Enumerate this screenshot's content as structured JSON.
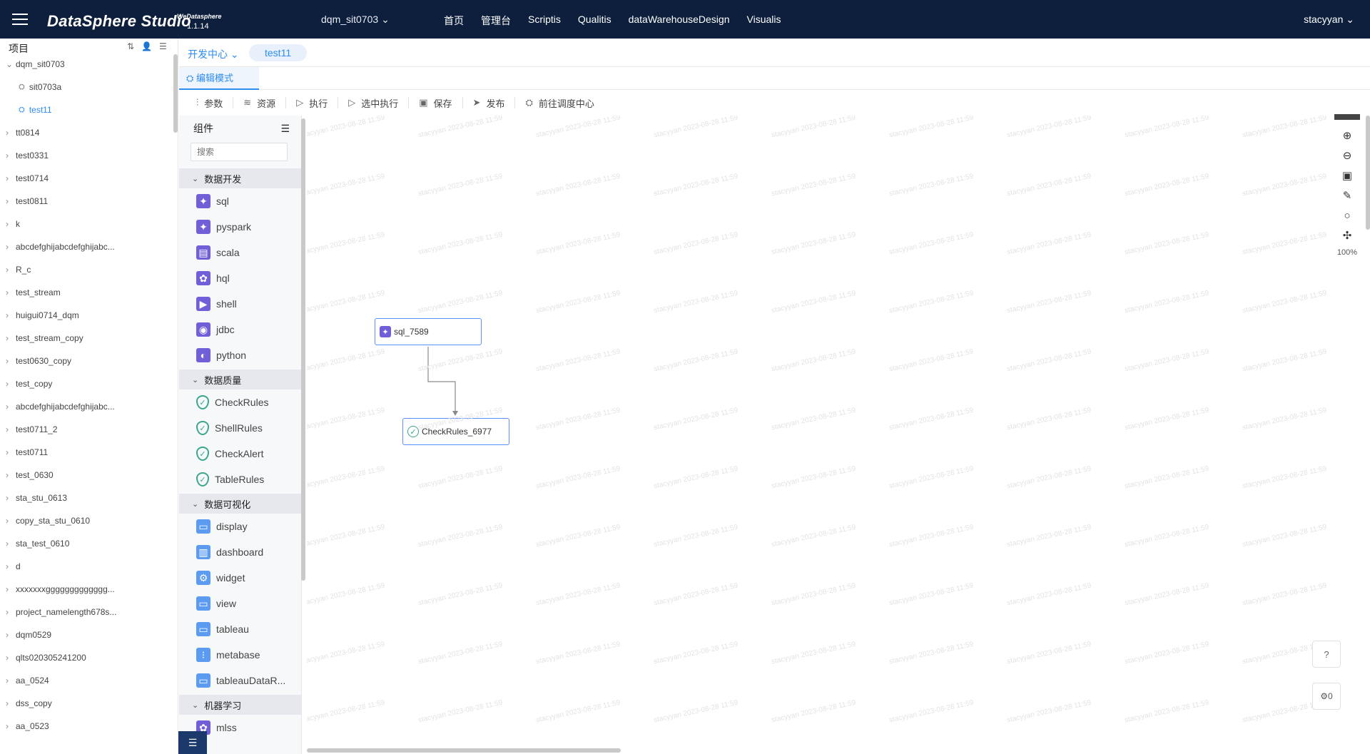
{
  "header": {
    "brand": "DataSphere Studio",
    "brand_sup": "WeDatasphere",
    "version": "1.1.14",
    "workspace": "dqm_sit0703",
    "nav": [
      "首页",
      "管理台",
      "Scriptis",
      "Qualitis",
      "dataWarehouseDesign",
      "Visualis"
    ],
    "user": "stacyyan"
  },
  "left_panel": {
    "title": "项目",
    "tree": [
      {
        "label": "dqm_sit0703",
        "expanded": true,
        "children": [
          {
            "label": "sit0703a",
            "active": false
          },
          {
            "label": "test11",
            "active": true
          }
        ]
      },
      {
        "label": "tt0814"
      },
      {
        "label": "test0331"
      },
      {
        "label": "test0714"
      },
      {
        "label": "test0811"
      },
      {
        "label": "k"
      },
      {
        "label": "abcdefghijabcdefghijabc..."
      },
      {
        "label": "R_c"
      },
      {
        "label": "test_stream"
      },
      {
        "label": "huigui0714_dqm"
      },
      {
        "label": "test_stream_copy"
      },
      {
        "label": "test0630_copy"
      },
      {
        "label": "test_copy"
      },
      {
        "label": "abcdefghijabcdefghijabc..."
      },
      {
        "label": "test0711_2"
      },
      {
        "label": "test0711"
      },
      {
        "label": "test_0630"
      },
      {
        "label": "sta_stu_0613"
      },
      {
        "label": "copy_sta_stu_0610"
      },
      {
        "label": "sta_test_0610"
      },
      {
        "label": "d"
      },
      {
        "label": "xxxxxxxggggggggggggg..."
      },
      {
        "label": "project_namelength678s..."
      },
      {
        "label": "dqm0529"
      },
      {
        "label": "qlts020305241200"
      },
      {
        "label": "aa_0524"
      },
      {
        "label": "dss_copy"
      },
      {
        "label": "aa_0523"
      }
    ]
  },
  "tabs": {
    "dev_center": "开发中心",
    "file_tab": "test11",
    "mode": "编辑模式"
  },
  "toolbar": [
    "参数",
    "资源",
    "执行",
    "选中执行",
    "保存",
    "发布",
    "前往调度中心"
  ],
  "components": {
    "title": "组件",
    "search_placeholder": "搜索",
    "categories": [
      {
        "name": "数据开发",
        "items": [
          "sql",
          "pyspark",
          "scala",
          "hql",
          "shell",
          "jdbc",
          "python"
        ]
      },
      {
        "name": "数据质量",
        "items": [
          "CheckRules",
          "ShellRules",
          "CheckAlert",
          "TableRules"
        ]
      },
      {
        "name": "数据可视化",
        "items": [
          "display",
          "dashboard",
          "widget",
          "view",
          "tableau",
          "metabase",
          "tableauDataR..."
        ]
      },
      {
        "name": "机器学习",
        "items": [
          "mlss"
        ]
      }
    ]
  },
  "canvas": {
    "nodes": [
      {
        "label": "sql_7589",
        "icon": "sql-icon"
      },
      {
        "label": "CheckRules_6977",
        "icon": "checkrules-icon"
      }
    ],
    "zoom": "100%",
    "watermark": "stacyyan 2023-08-28 11:59",
    "counter": "0"
  },
  "colors": {
    "header_bg": "#0d1f3c",
    "accent": "#2d8cf0",
    "node_border": "#5b8ff9"
  }
}
